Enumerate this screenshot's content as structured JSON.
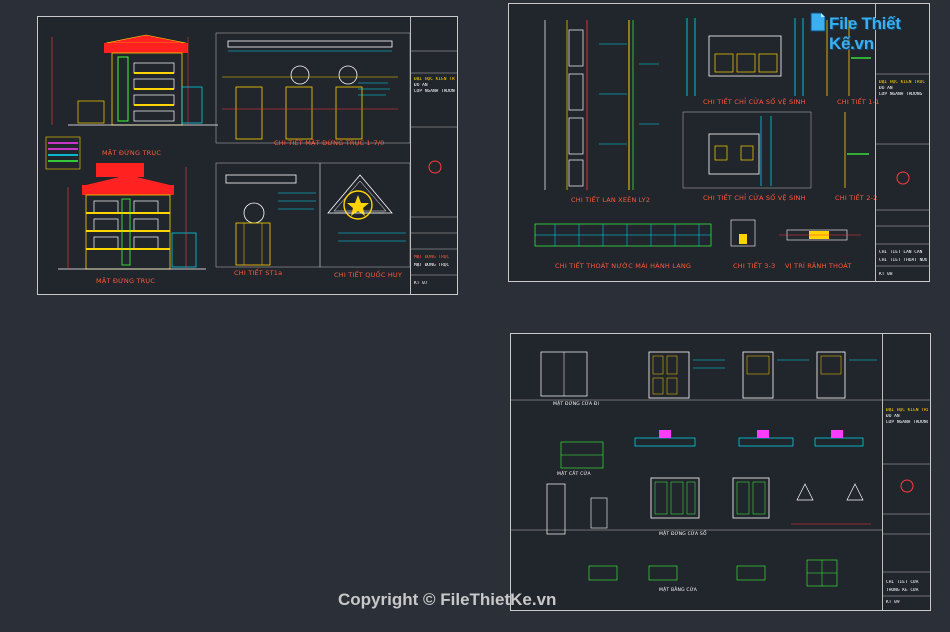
{
  "watermark": {
    "logo_text": "File Thiết Kế.vn",
    "copyright": "Copyright © FileThietKe.vn"
  },
  "colors": {
    "background": "#2b3038",
    "sheet_border": "#c9c9c9",
    "title_red": "#ff5a3c",
    "cad_yellow": "#ffd400",
    "cad_cyan": "#00e5ff",
    "cad_green": "#3cff3c",
    "cad_magenta": "#ff3cff",
    "logo_blue": "#3ab0f0"
  },
  "sheet1": {
    "captions": {
      "left_elevation": "MẶT ĐỨNG TRỤC",
      "right_elevation": "MẶT ĐỨNG TRỤC",
      "detail_main": "CHI TIẾT MẶT ĐỨNG TRỤC 1-7/0",
      "detail_a": "CHI TIẾT ST1a",
      "detail_b": "CHI TIẾT QUỐC HUY"
    },
    "title_block": {
      "line1": "ĐẠI HỌC KIẾN TRÚC",
      "line2": "ĐỒ ÁN",
      "line3": "LỚP NGÀNH TRƯỜNG",
      "line4": "MẶT ĐỨNG TRỤC",
      "line5": "MẶT ĐỨNG TRỤC",
      "sheet_no": "KT 07"
    }
  },
  "sheet2": {
    "captions": {
      "detail_left": "CHI TIẾT LAN XEÊN LY2",
      "detail_mid_top": "CHI TIẾT CHỈ CỬA SỔ VỆ SINH",
      "detail_right_top": "CHI TIẾT 1-1",
      "detail_mid_bottom": "CHI TIẾT CHỈ CỬA SỔ VỆ SINH",
      "detail_right_bottom": "CHI TIẾT 2-2",
      "detail_bottom_left": "CHI TIẾT THOÁT NƯỚC MÁI HÀNH LANG",
      "detail_bottom_mid": "CHI TIẾT 3-3",
      "detail_bottom_right": "VỊ TRÍ RÃNH THOÁT"
    },
    "title_block": {
      "line1": "ĐẠI HỌC KIẾN TRÚC",
      "line2": "ĐỒ ÁN",
      "line3": "LỚP NGÀNH TRƯỜNG",
      "line4": "CHI TIẾT LAN CAN",
      "line5": "CHI TIẾT THOÁT NƯỚC",
      "sheet_no": "KT 08"
    }
  },
  "sheet3": {
    "captions": {
      "row1": "MẶT ĐỨNG CỬA ĐI",
      "row2": "MẶT CẮT CỬA",
      "row3": "MẶT ĐỨNG CỬA SỔ",
      "row4": "MẶT BẰNG CỬA"
    },
    "title_block": {
      "line1": "ĐẠI HỌC KIẾN TRÚC",
      "line2": "ĐỒ ÁN",
      "line3": "LỚP NGÀNH TRƯỜNG",
      "line4": "CHI TIẾT CỬA",
      "line5": "THỐNG KÊ CỬA",
      "sheet_no": "KT 09"
    }
  }
}
